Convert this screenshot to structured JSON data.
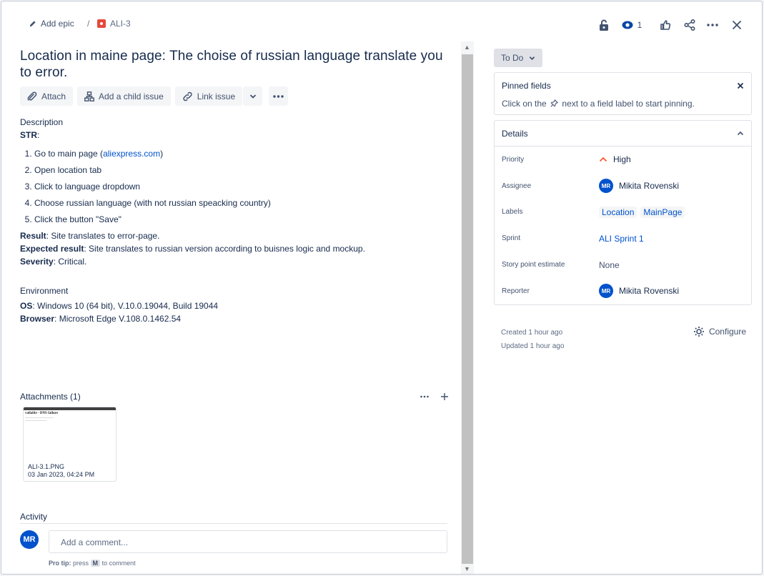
{
  "breadcrumb": {
    "add_epic": "Add epic",
    "separator": "/",
    "issue_key": "ALI-3"
  },
  "top_actions": {
    "watchers_count": "1"
  },
  "issue": {
    "summary": "Location in maine page: The choise of russian language translate you to error.",
    "toolbar": {
      "attach": "Attach",
      "add_child": "Add a child issue",
      "link_issue": "Link issue"
    },
    "description_label": "Description",
    "str_label": "STR",
    "str_colon": ":",
    "steps": [
      {
        "pre": "Go to main page (",
        "link": "aliexpress.com",
        "post": ")"
      },
      {
        "text": "Open location tab"
      },
      {
        "text": "Click to language dropdown"
      },
      {
        "text": "Choose russian language (with not russian speacking country)"
      },
      {
        "text": "Click the button \"Save\""
      }
    ],
    "result_label": "Result",
    "result_text": ": Site translates to error-page.",
    "expected_label": "Expected result",
    "expected_text": ": Site translates to russian version according to buisnes logic and mockup.",
    "severity_label": "Severity",
    "severity_text": ": Critical.",
    "environment_label": "Environment",
    "os_label": "OS",
    "os_text": ": Windows 10 (64 bit), V.10.0.19044, Build 19044",
    "browser_label": "Browser",
    "browser_text": ": Microsoft Edge V.108.0.1462.54"
  },
  "attachments": {
    "header": "Attachments (1)",
    "items": [
      {
        "thumb_title": "vailable - DNS failure",
        "name": "ALI-3.1.PNG",
        "date": "03 Jan 2023, 04:24 PM"
      }
    ]
  },
  "activity": {
    "label": "Activity",
    "avatar": "MR",
    "placeholder": "Add a comment...",
    "protip_bold": "Pro tip:",
    "protip_press": "press",
    "protip_key": "M",
    "protip_rest": "to comment"
  },
  "sidebar": {
    "status": "To Do",
    "pinned": {
      "title": "Pinned fields",
      "text_before": "Click on the",
      "text_after": "next to a field label to start pinning."
    },
    "details": {
      "title": "Details",
      "priority_label": "Priority",
      "priority_value": "High",
      "assignee_label": "Assignee",
      "assignee_initials": "MR",
      "assignee_name": "Mikita Rovenski",
      "labels_label": "Labels",
      "labels": [
        "Location",
        "MainPage"
      ],
      "sprint_label": "Sprint",
      "sprint_value": "ALI Sprint 1",
      "story_label": "Story point estimate",
      "story_value": "None",
      "reporter_label": "Reporter",
      "reporter_initials": "MR",
      "reporter_name": "Mikita Rovenski"
    },
    "created": "Created 1 hour ago",
    "updated": "Updated 1 hour ago",
    "configure": "Configure"
  },
  "colors": {
    "link": "#0052cc",
    "priority_high": "#ff5630",
    "bug": "#e5493a",
    "avatar": "#0052cc"
  }
}
